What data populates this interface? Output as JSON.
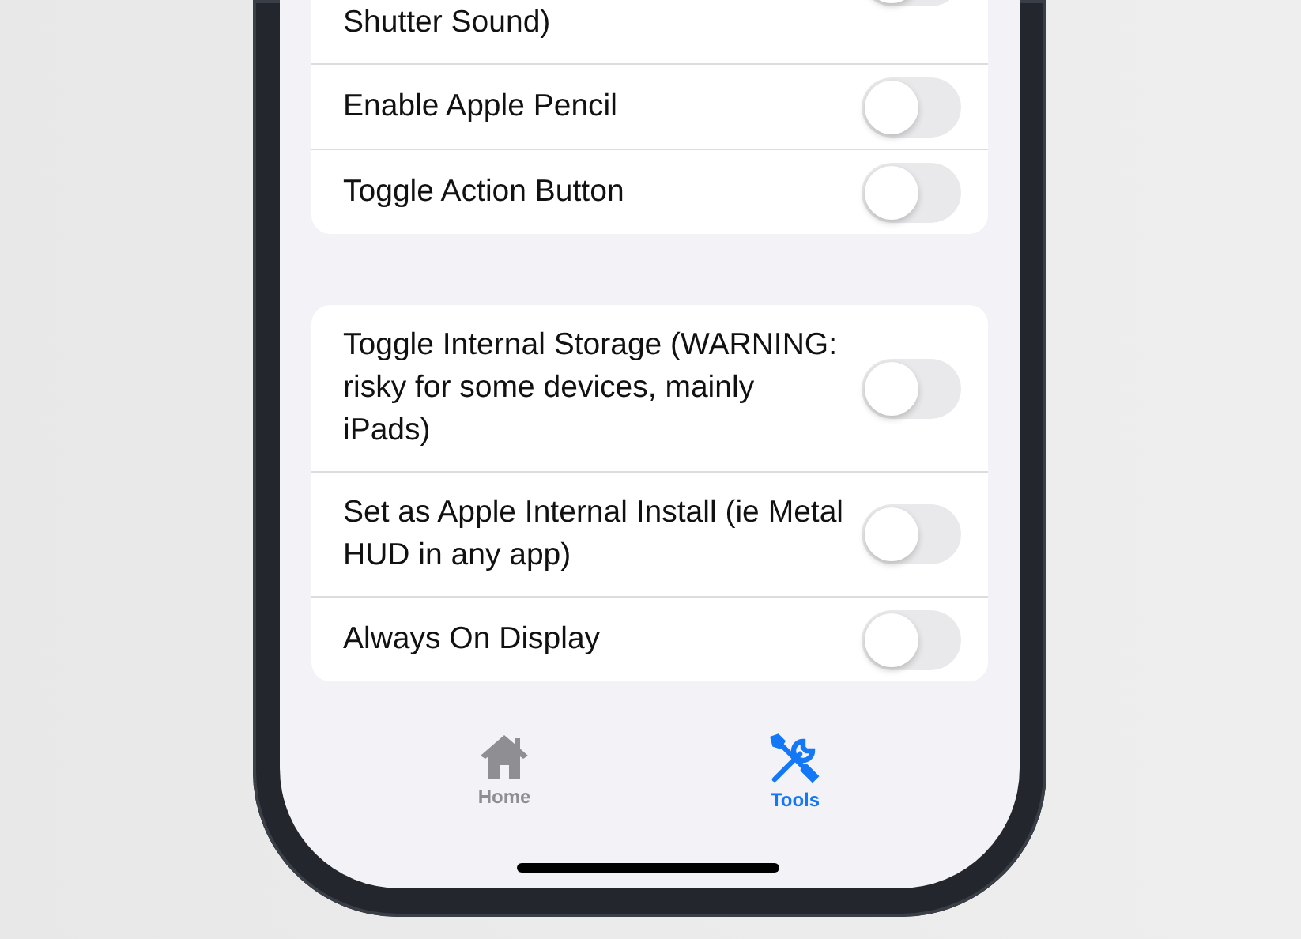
{
  "settings_groups": [
    {
      "rows": [
        {
          "label": "Shutter Sound)",
          "on": false
        },
        {
          "label": "Enable Apple Pencil",
          "on": false
        },
        {
          "label": "Toggle Action Button",
          "on": false
        }
      ]
    },
    {
      "rows": [
        {
          "label": "Toggle Internal Storage (WARNING: risky for some devices, mainly iPads)",
          "on": false
        },
        {
          "label": "Set as Apple Internal Install (ie Metal HUD in any app)",
          "on": false
        },
        {
          "label": "Always On Display",
          "on": false
        }
      ]
    }
  ],
  "tab_bar": [
    {
      "kind": "home",
      "label": "Home",
      "selected": false
    },
    {
      "kind": "tools",
      "label": "Tools",
      "selected": true
    }
  ]
}
